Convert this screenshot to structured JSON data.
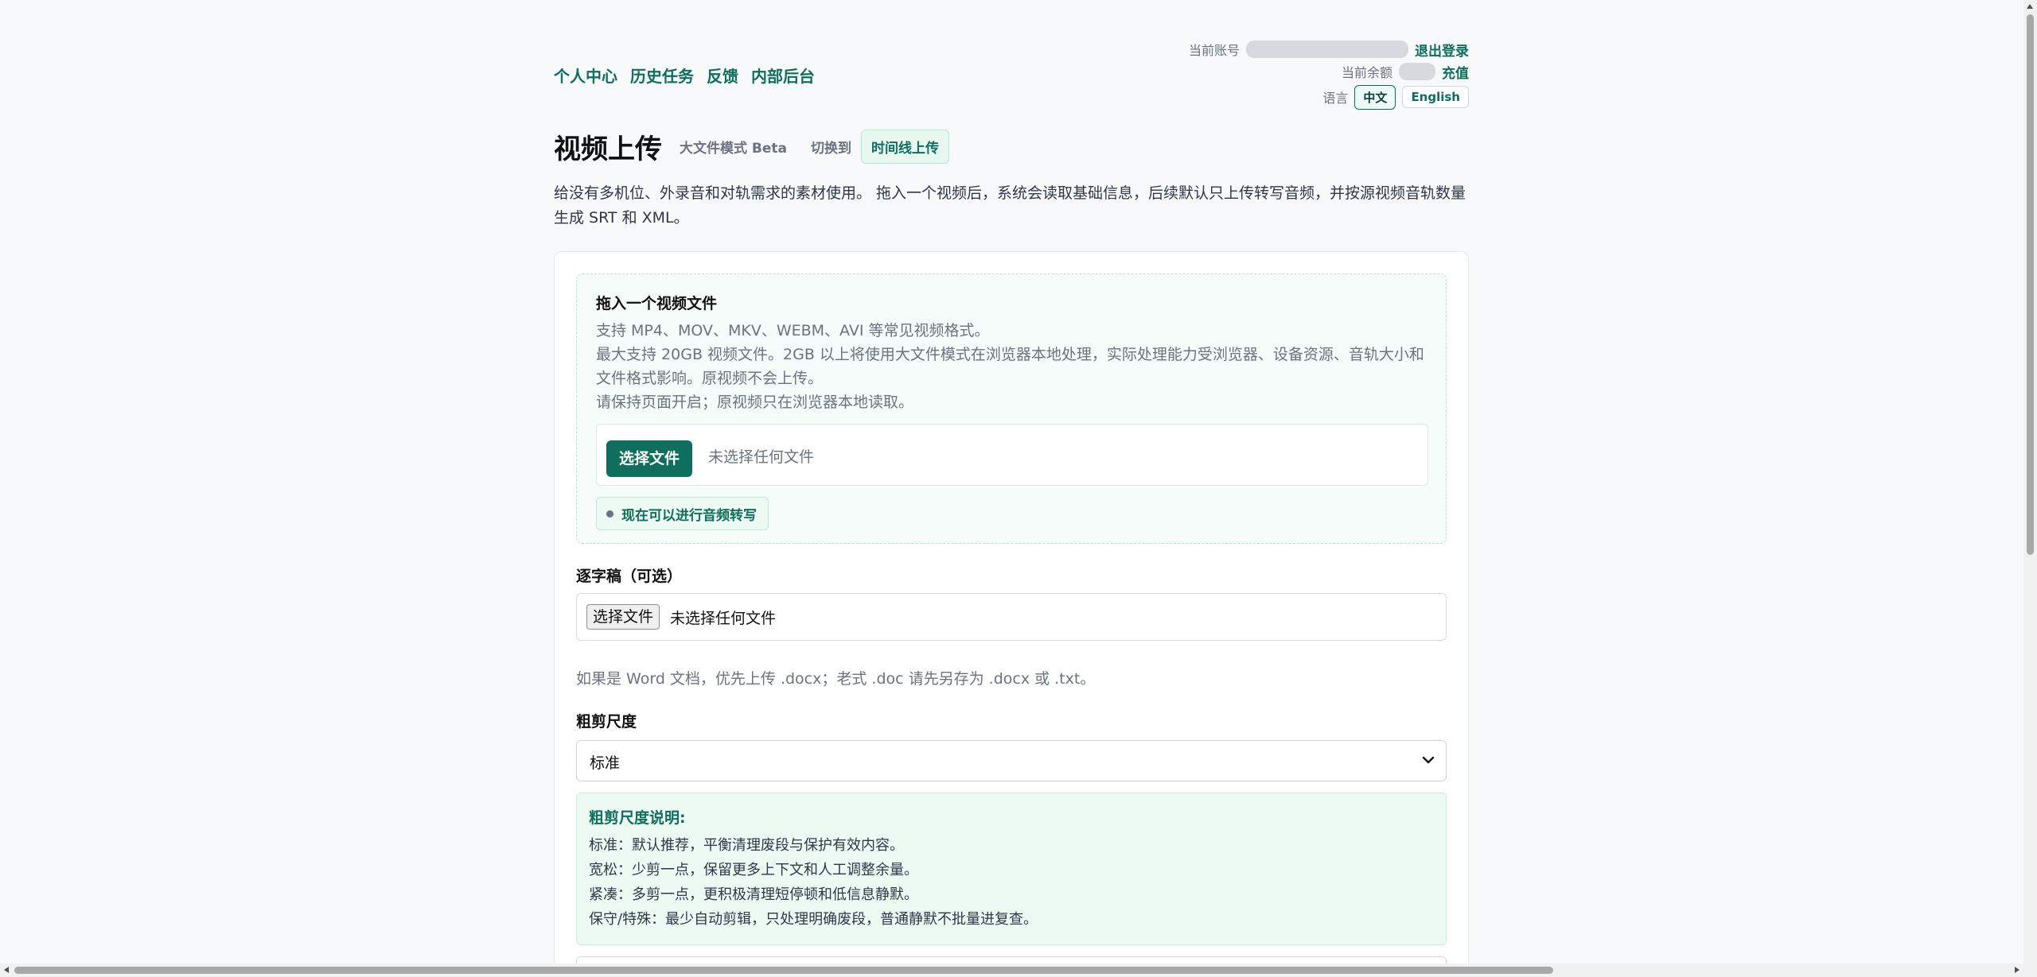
{
  "nav": {
    "items": [
      "个人中心",
      "历史任务",
      "反馈",
      "内部后台"
    ]
  },
  "account": {
    "label": "当前账号",
    "logout": "退出登录",
    "balance_label": "当前余额",
    "recharge": "充值",
    "lang_label": "语言",
    "lang_zh": "中文",
    "lang_en": "English"
  },
  "header": {
    "title": "视频上传",
    "mode": "大文件模式 Beta",
    "switch_label": "切换到",
    "timeline_button": "时间线上传",
    "description": "给没有多机位、外录音和对轨需求的素材使用。 拖入一个视频后，系统会读取基础信息，后续默认只上传转写音频，并按源视频音轨数量生成 SRT 和 XML。"
  },
  "dropzone": {
    "title": "拖入一个视频文件",
    "lines": [
      "支持 MP4、MOV、MKV、WEBM、AVI 等常见视频格式。",
      "最大支持 20GB 视频文件。2GB 以上将使用大文件模式在浏览器本地处理，实际处理能力受浏览器、设备资源、音轨大小和文件格式影响。原视频不会上传。",
      "请保持页面开启；原视频只在浏览器本地读取。"
    ],
    "choose_button": "选择文件",
    "no_file": "未选择任何文件",
    "status": "现在可以进行音频转写"
  },
  "transcript": {
    "label": "逐字稿（可选）",
    "choose_button": "选择文件",
    "no_file": "未选择任何文件",
    "hint": "如果是 Word 文档，优先上传 .docx；老式 .doc 请先另存为 .docx 或 .txt。"
  },
  "cut": {
    "label": "粗剪尺度",
    "selected": "标准",
    "explain_title": "粗剪尺度说明:",
    "explain_lines": [
      "标准：默认推荐，平衡清理废段与保护有效内容。",
      "宽松：少剪一点，保留更多上下文和人工调整余量。",
      "紧凑：多剪一点，更积极清理短停顿和低信息静默。",
      "保守/特殊：最少自动剪辑，只处理明确废段，普通静默不批量进复查。"
    ]
  },
  "colors": {
    "accent": "#0f6e5c",
    "accent_light": "#ecfaf3",
    "background": "#f7f9fb"
  }
}
